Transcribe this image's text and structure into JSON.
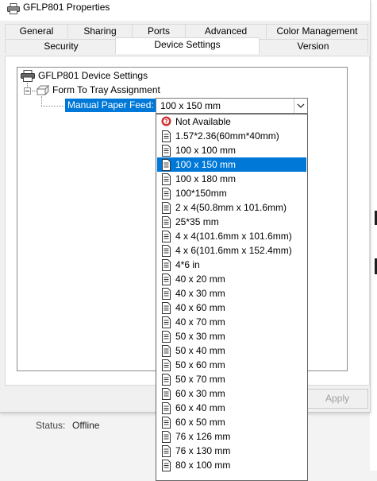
{
  "window": {
    "title": "GFLP801 Properties"
  },
  "tabs_row1": [
    {
      "label": "General"
    },
    {
      "label": "Sharing"
    },
    {
      "label": "Ports"
    },
    {
      "label": "Advanced"
    },
    {
      "label": "Color Management"
    }
  ],
  "tabs_row2": [
    {
      "label": "Security"
    },
    {
      "label": "Device Settings",
      "active": true
    },
    {
      "label": "Version"
    }
  ],
  "tree": {
    "root": "GFLP801 Device Settings",
    "child": "Form To Tray Assignment",
    "setting_label": "Manual Paper Feed:",
    "setting_value": "100 x 150 mm"
  },
  "dropdown": {
    "selected": "100 x 150 mm",
    "options": [
      "Not Available",
      "1.57*2.36(60mm*40mm)",
      "100 x 100 mm",
      "100 x 150 mm",
      "100 x 180 mm",
      "100*150mm",
      "2 x 4(50.8mm x 101.6mm)",
      "25*35 mm",
      "4 x 4(101.6mm x 101.6mm)",
      "4 x 6(101.6mm x 152.4mm)",
      "4*6 in",
      "40 x 20 mm",
      "40 x 30 mm",
      "40 x 60 mm",
      "40 x 70 mm",
      "50 x 30 mm",
      "50 x 40 mm",
      "50 x 60 mm",
      "50 x 70 mm",
      "60 x 30 mm",
      "60 x 40 mm",
      "60 x 50 mm",
      "76 x 126 mm",
      "76 x 130 mm",
      "80 x 100 mm"
    ]
  },
  "buttons": {
    "apply": "Apply"
  },
  "status": {
    "label": "Status:",
    "value": "Offline"
  },
  "colors": {
    "selection": "#0078d7",
    "not_available_icon": "#d32f2f"
  }
}
